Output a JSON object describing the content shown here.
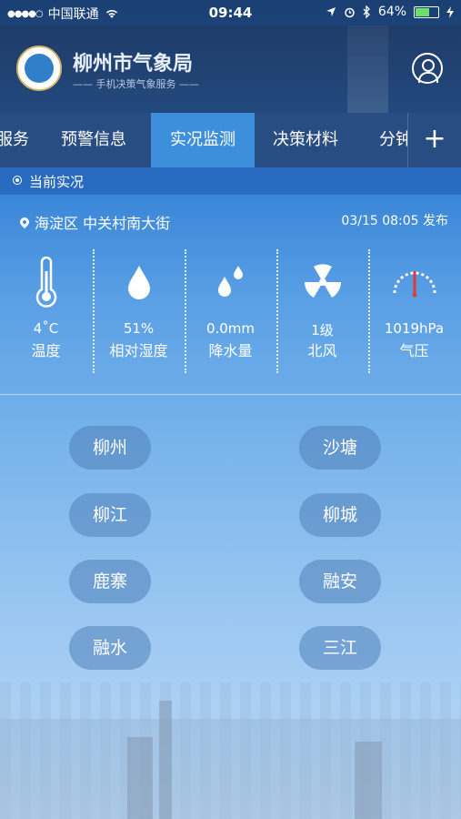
{
  "status_bar": {
    "carrier": "中国联通",
    "time": "09:44",
    "battery": "64%"
  },
  "header": {
    "org_name": "柳州市气象局",
    "subtitle": "——  手机决策气象服务  ——"
  },
  "tabs": [
    {
      "label": "服务"
    },
    {
      "label": "预警信息"
    },
    {
      "label": "实况监测",
      "active": true
    },
    {
      "label": "决策材料"
    },
    {
      "label": "分钟"
    }
  ],
  "add_label": "+",
  "section": {
    "label": "当前实况"
  },
  "location": {
    "text": "海淀区 中关村南大街",
    "published": "03/15 08:05 发布"
  },
  "metrics": [
    {
      "value": "4˚C",
      "name": "温度",
      "icon": "thermometer-icon"
    },
    {
      "value": "51%",
      "name": "相对湿度",
      "icon": "droplet-icon"
    },
    {
      "value": "0.0mm",
      "name": "降水量",
      "icon": "rain-drops-icon"
    },
    {
      "value": "1级",
      "name": "北风",
      "icon": "fan-icon"
    },
    {
      "value": "1019hPa",
      "name": "气压",
      "icon": "gauge-icon"
    }
  ],
  "cities": [
    {
      "label": "柳州"
    },
    {
      "label": "沙塘"
    },
    {
      "label": "柳江"
    },
    {
      "label": "柳城"
    },
    {
      "label": "鹿寨"
    },
    {
      "label": "融安"
    },
    {
      "label": "融水"
    },
    {
      "label": "三江"
    }
  ],
  "colors": {
    "header": "#22497d",
    "tab_active": "#3d8fdb",
    "section_bar": "#2a6bc2",
    "battery": "#6de06b"
  }
}
